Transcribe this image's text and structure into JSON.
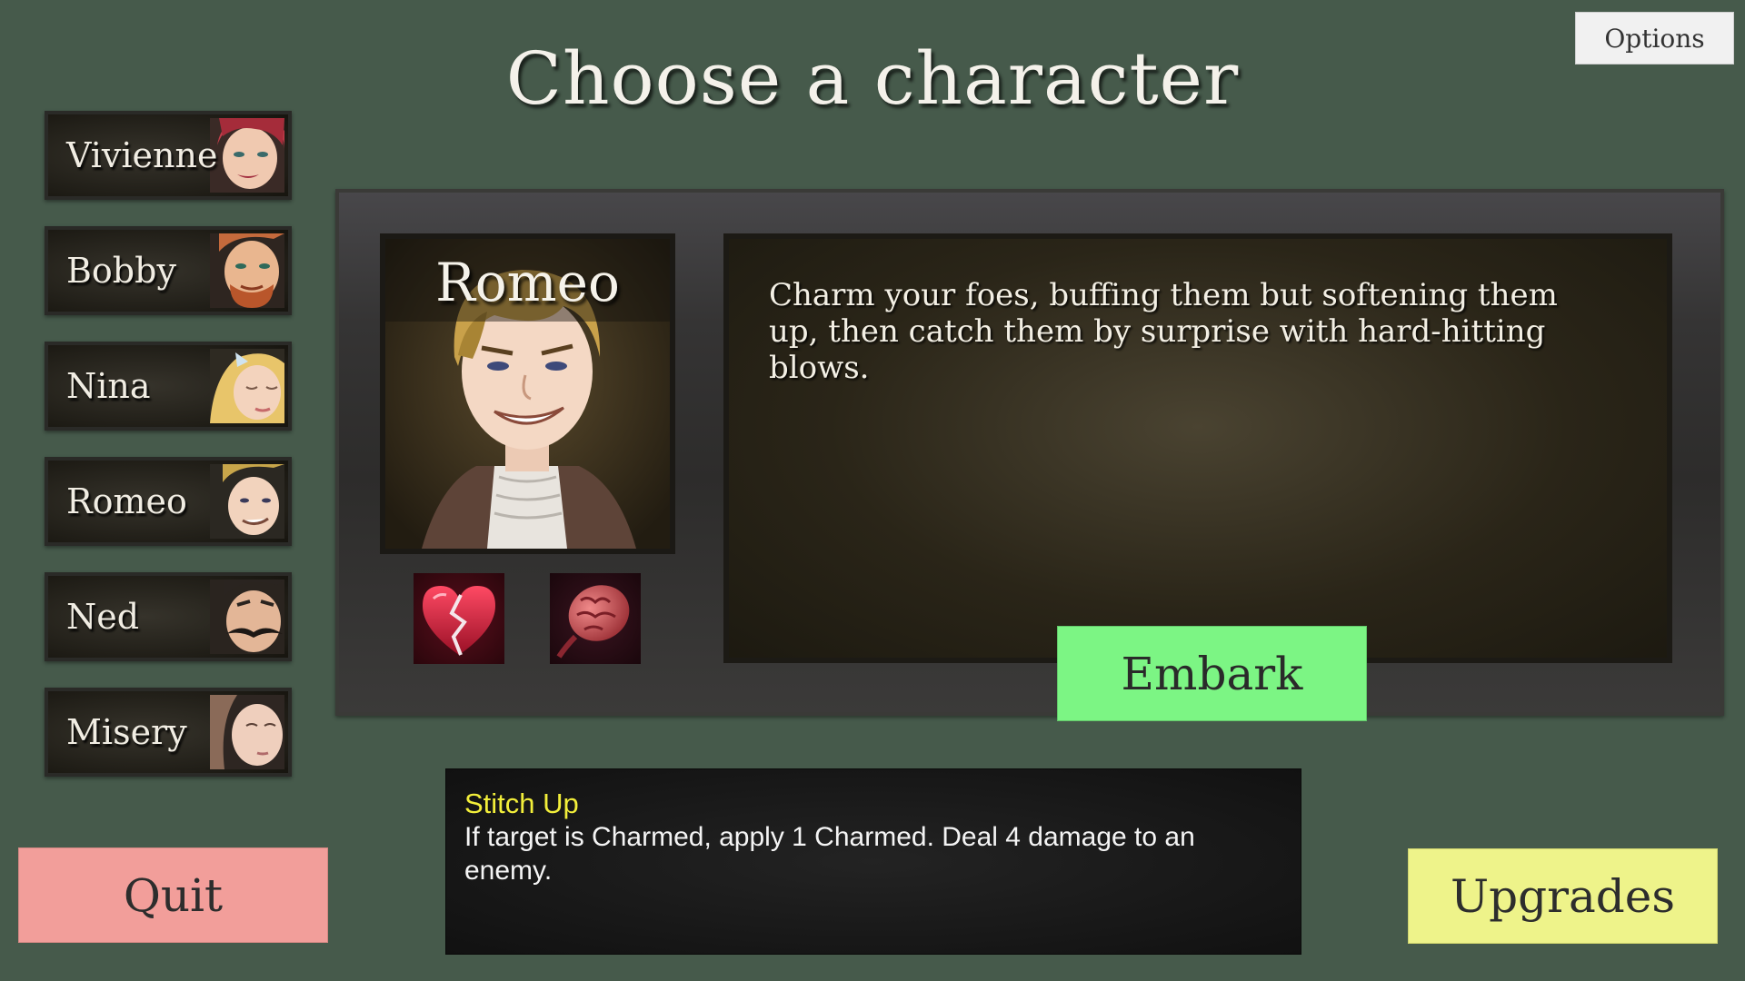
{
  "title": "Choose a character",
  "options_label": "Options",
  "characters": [
    {
      "name": "Vivienne",
      "portrait_icon": "vivienne-portrait-icon",
      "accent": "#c23d4a"
    },
    {
      "name": "Bobby",
      "portrait_icon": "bobby-portrait-icon",
      "accent": "#c56a3c"
    },
    {
      "name": "Nina",
      "portrait_icon": "nina-portrait-icon",
      "accent": "#e8c56a"
    },
    {
      "name": "Romeo",
      "portrait_icon": "romeo-portrait-icon",
      "accent": "#c8a64a"
    },
    {
      "name": "Ned",
      "portrait_icon": "ned-portrait-icon",
      "accent": "#2a2420"
    },
    {
      "name": "Misery",
      "portrait_icon": "misery-portrait-icon",
      "accent": "#8a6a58"
    }
  ],
  "selected": {
    "name": "Romeo",
    "description": "Charm your foes, buffing them but softening them up, then catch them by surprise with hard-hitting blows.",
    "cards": [
      {
        "icon": "broken-heart-icon"
      },
      {
        "icon": "brain-icon"
      }
    ]
  },
  "embark_label": "Embark",
  "tooltip": {
    "title": "Stitch Up",
    "body": "If target is Charmed, apply 1 Charmed. Deal 4 damage to an enemy."
  },
  "quit_label": "Quit",
  "upgrades_label": "Upgrades",
  "colors": {
    "background": "#465a4b",
    "embark": "#7cf584",
    "quit": "#f29e9a",
    "upgrades": "#eef38a",
    "tooltip_title": "#f2ee3a"
  }
}
